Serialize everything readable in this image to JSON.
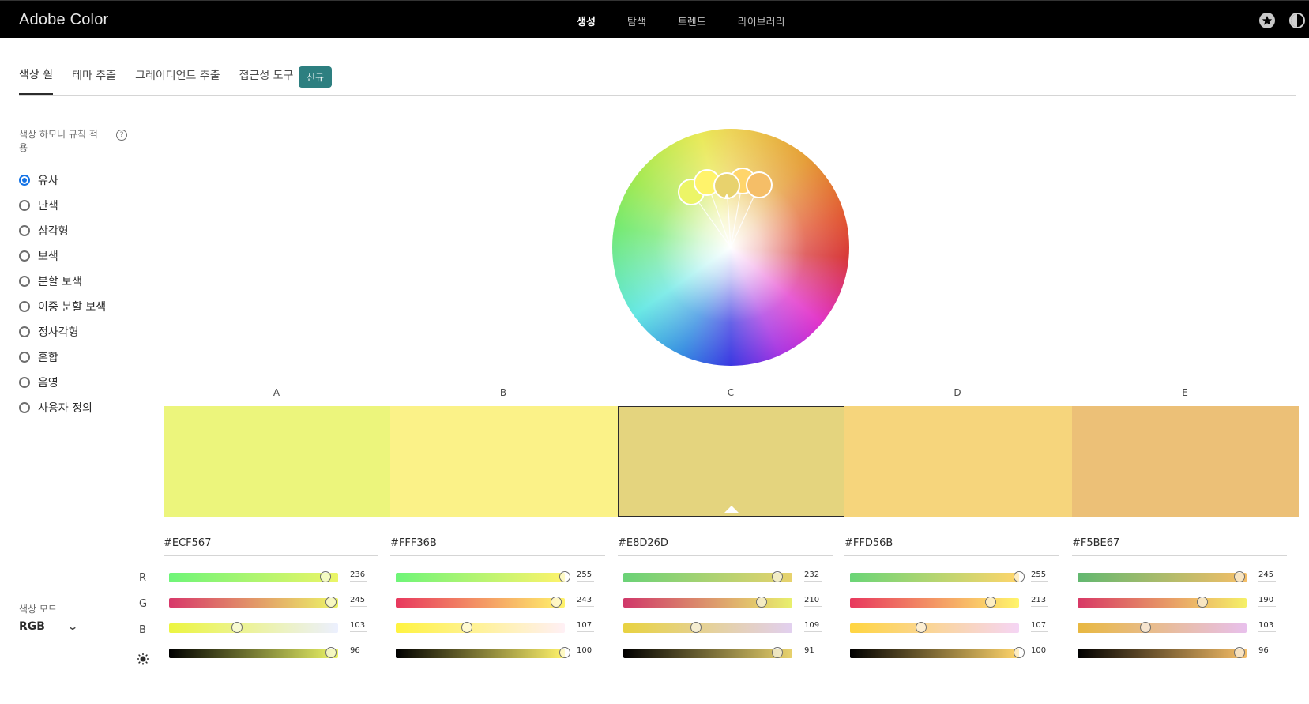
{
  "header": {
    "brand": "Adobe Color",
    "nav": [
      "생성",
      "탐색",
      "트렌드",
      "라이브러리"
    ],
    "active_nav": 0
  },
  "tabs": {
    "items": [
      "색상 휠",
      "테마 추출",
      "그레이디언트 추출",
      "접근성 도구"
    ],
    "active": 0,
    "badge": "신규"
  },
  "sidebar": {
    "rule_title": "색상 하모니 규칙 적용",
    "help": "?",
    "rules": [
      "유사",
      "단색",
      "삼각형",
      "보색",
      "분할 보색",
      "이중 분할 보색",
      "정사각형",
      "혼합",
      "음영",
      "사용자 정의"
    ],
    "selected": 0,
    "mode_title": "색상 모드",
    "mode_value": "RGB",
    "channels": [
      "R",
      "G",
      "B"
    ],
    "brightness_icon": "sun-icon"
  },
  "palette": [
    {
      "label": "A",
      "hex": "#ECF567",
      "r": "236",
      "g": "245",
      "b": "103",
      "br": "96"
    },
    {
      "label": "B",
      "hex": "#FFF36B",
      "r": "255",
      "g": "243",
      "b": "107",
      "br": "100"
    },
    {
      "label": "C",
      "hex": "#E8D26D",
      "r": "232",
      "g": "210",
      "b": "109",
      "br": "91"
    },
    {
      "label": "D",
      "hex": "#FFD56B",
      "r": "255",
      "g": "213",
      "b": "107",
      "br": "100"
    },
    {
      "label": "E",
      "hex": "#F5BE67",
      "r": "245",
      "g": "190",
      "b": "103",
      "br": "96"
    }
  ],
  "selected_swatch": 2,
  "swatch_colors": [
    "#ecf57c",
    "#fbf288",
    "#e4d47e",
    "#f6d57c",
    "#ecc077"
  ],
  "icons": [
    "star-icon",
    "contrast-icon",
    "help-icon",
    "chevron-down-icon",
    "sun-icon"
  ]
}
